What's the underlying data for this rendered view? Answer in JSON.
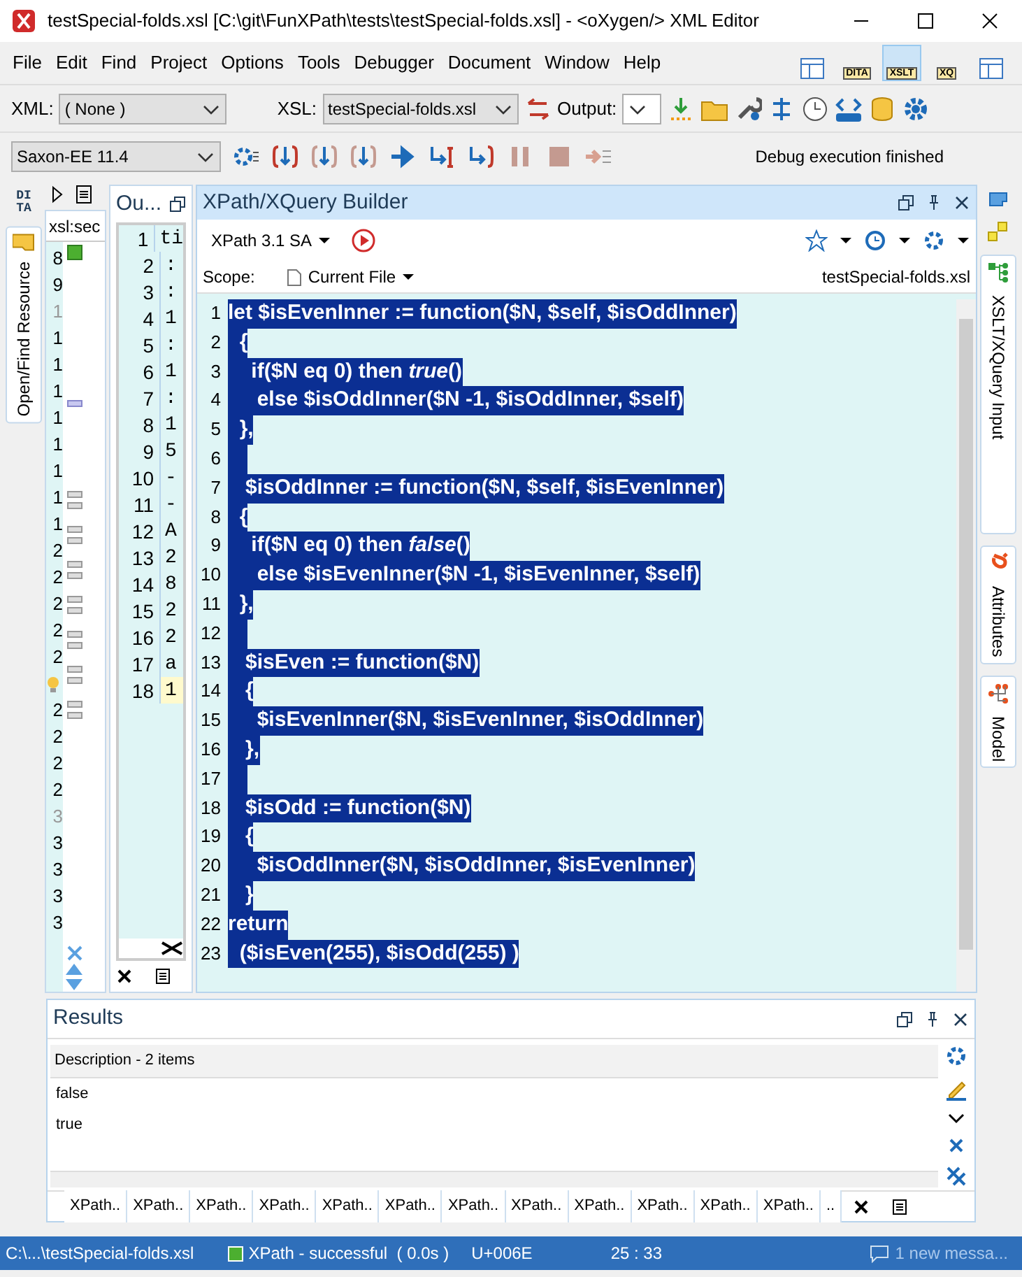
{
  "window": {
    "title": "testSpecial-folds.xsl [C:\\git\\FunXPath\\tests\\testSpecial-folds.xsl] - <oXygen/> XML Editor"
  },
  "menu": [
    "File",
    "Edit",
    "Find",
    "Project",
    "Options",
    "Tools",
    "Debugger",
    "Document",
    "Window",
    "Help"
  ],
  "perspectives": [
    {
      "selected": false
    },
    {
      "label": "DITA",
      "selected": false
    },
    {
      "label": "XSLT",
      "selected": true
    },
    {
      "label": "XQ",
      "selected": false
    },
    {
      "selected": false
    }
  ],
  "toolbar": {
    "xml_label": "XML:",
    "xml_value": "( None )",
    "xsl_label": "XSL:",
    "xsl_value": "testSpecial-folds.xsl",
    "output_label": "Output:"
  },
  "debug_toolbar": {
    "engine": "Saxon-EE 11.4",
    "status": "Debug execution finished"
  },
  "left_tabs": [
    {
      "label": "DI TA",
      "kind": "logo"
    },
    {
      "label": "Open/Find Resource",
      "kind": "tab"
    }
  ],
  "source_editor": {
    "tab": "xsl:sec",
    "lines": [
      {
        "number": "8",
        "dimmed": false
      },
      {
        "number": "9",
        "dimmed": false
      },
      {
        "number": "1",
        "dimmed": true
      },
      {
        "number": "1",
        "dimmed": false
      },
      {
        "number": "1",
        "dimmed": false
      },
      {
        "number": "1",
        "dimmed": false
      },
      {
        "number": "1",
        "dimmed": false
      },
      {
        "number": "1",
        "dimmed": false
      },
      {
        "number": "1",
        "dimmed": false
      },
      {
        "number": "1",
        "dimmed": false
      },
      {
        "number": "1",
        "dimmed": false
      },
      {
        "number": "2",
        "dimmed": false
      },
      {
        "number": "2",
        "dimmed": false
      },
      {
        "number": "2",
        "dimmed": false
      },
      {
        "number": "2",
        "dimmed": false
      },
      {
        "number": "2",
        "dimmed": false
      },
      {
        "kind": "bulb"
      },
      {
        "number": "2",
        "dimmed": false
      },
      {
        "number": "2",
        "dimmed": false
      },
      {
        "number": "2",
        "dimmed": false
      },
      {
        "number": "2",
        "dimmed": false
      },
      {
        "number": "3",
        "dimmed": true
      },
      {
        "number": "3",
        "dimmed": false
      },
      {
        "number": "3",
        "dimmed": false
      },
      {
        "number": "3",
        "dimmed": false
      },
      {
        "number": "3",
        "dimmed": false
      }
    ]
  },
  "outline": {
    "title": "Ou...",
    "rows": [
      {
        "number": "1",
        "text": "ti",
        "selected": false
      },
      {
        "number": "2",
        "text": ":",
        "selected": false
      },
      {
        "number": "3",
        "text": ":",
        "selected": false
      },
      {
        "number": "4",
        "text": "1",
        "selected": false
      },
      {
        "number": "5",
        "text": ":",
        "selected": false
      },
      {
        "number": "6",
        "text": "1",
        "selected": false
      },
      {
        "number": "7",
        "text": ":",
        "selected": false
      },
      {
        "number": "8",
        "text": "1",
        "selected": false
      },
      {
        "number": "9",
        "text": "5",
        "selected": false
      },
      {
        "number": "10",
        "text": "-",
        "selected": false
      },
      {
        "number": "11",
        "text": "-",
        "selected": false
      },
      {
        "number": "12",
        "text": "A",
        "selected": false
      },
      {
        "number": "13",
        "text": "2",
        "selected": false
      },
      {
        "number": "14",
        "text": "8",
        "selected": false
      },
      {
        "number": "15",
        "text": "2",
        "selected": false
      },
      {
        "number": "16",
        "text": "2",
        "selected": false
      },
      {
        "number": "17",
        "text": "a",
        "selected": false
      },
      {
        "number": "18",
        "text": "1",
        "selected": true
      }
    ]
  },
  "builder": {
    "title": "XPath/XQuery Builder",
    "version": "XPath 3.1 SA",
    "scope_label": "Scope:",
    "scope_value": "Current File",
    "file": "testSpecial-folds.xsl",
    "lines": [
      {
        "number": "1",
        "text": "let $isEvenInner := function($N, $self, $isOddInner)",
        "selected": true
      },
      {
        "number": "2",
        "text": "  {",
        "selected": true
      },
      {
        "number": "3",
        "text": "    if($N eq 0) then *true*()",
        "selected": true
      },
      {
        "number": "4",
        "text": "     else $isOddInner($N -1, $isOddInner, $self)",
        "selected": true
      },
      {
        "number": "5",
        "text": "  },",
        "selected": true
      },
      {
        "number": "6",
        "selected": true
      },
      {
        "number": "7",
        "text": "   $isOddInner := function($N, $self, $isEvenInner)",
        "selected": true
      },
      {
        "number": "8",
        "text": "  {",
        "selected": true
      },
      {
        "number": "9",
        "text": "    if($N eq 0) then *false*()",
        "selected": true
      },
      {
        "number": "10",
        "text": "     else $isEvenInner($N -1, $isEvenInner, $self)",
        "selected": true
      },
      {
        "number": "11",
        "text": "  },",
        "selected": true
      },
      {
        "number": "12",
        "selected": true
      },
      {
        "number": "13",
        "text": "   $isEven := function($N)",
        "selected": true
      },
      {
        "number": "14",
        "text": "   {",
        "selected": true
      },
      {
        "number": "15",
        "text": "     $isEvenInner($N, $isEvenInner, $isOddInner)",
        "selected": true
      },
      {
        "number": "16",
        "text": "   },",
        "selected": true
      },
      {
        "number": "17",
        "selected": true
      },
      {
        "number": "18",
        "text": "   $isOdd := function($N)",
        "selected": true
      },
      {
        "number": "19",
        "text": "   {",
        "selected": true
      },
      {
        "number": "20",
        "text": "     $isOddInner($N, $isOddInner, $isEvenInner)",
        "selected": true
      },
      {
        "number": "21",
        "text": "   }",
        "selected": true
      },
      {
        "number": "22",
        "text": "return",
        "selected": true
      },
      {
        "number": "23",
        "text": "  ($isEven(255), $isOdd(255) )",
        "selected": true
      }
    ]
  },
  "right_tabs": [
    "XSLT/XQuery Input",
    "Attributes",
    "Model"
  ],
  "results": {
    "title": "Results",
    "column": "Description - 2 items",
    "rows": [
      "false",
      "true"
    ],
    "tabs": [
      "XPath..",
      "XPath..",
      "XPath..",
      "XPath..",
      "XPath..",
      "XPath..",
      "XPath..",
      "XPath..",
      "XPath..",
      "XPath..",
      "XPath..",
      "XPath..",
      ".."
    ]
  },
  "status_bar": {
    "path": "C:\\...\\testSpecial-folds.xsl",
    "result": "XPath - successful  ( 0.0s )",
    "char": "U+006E",
    "position": "25 : 33",
    "messages": "1 new messa..."
  }
}
